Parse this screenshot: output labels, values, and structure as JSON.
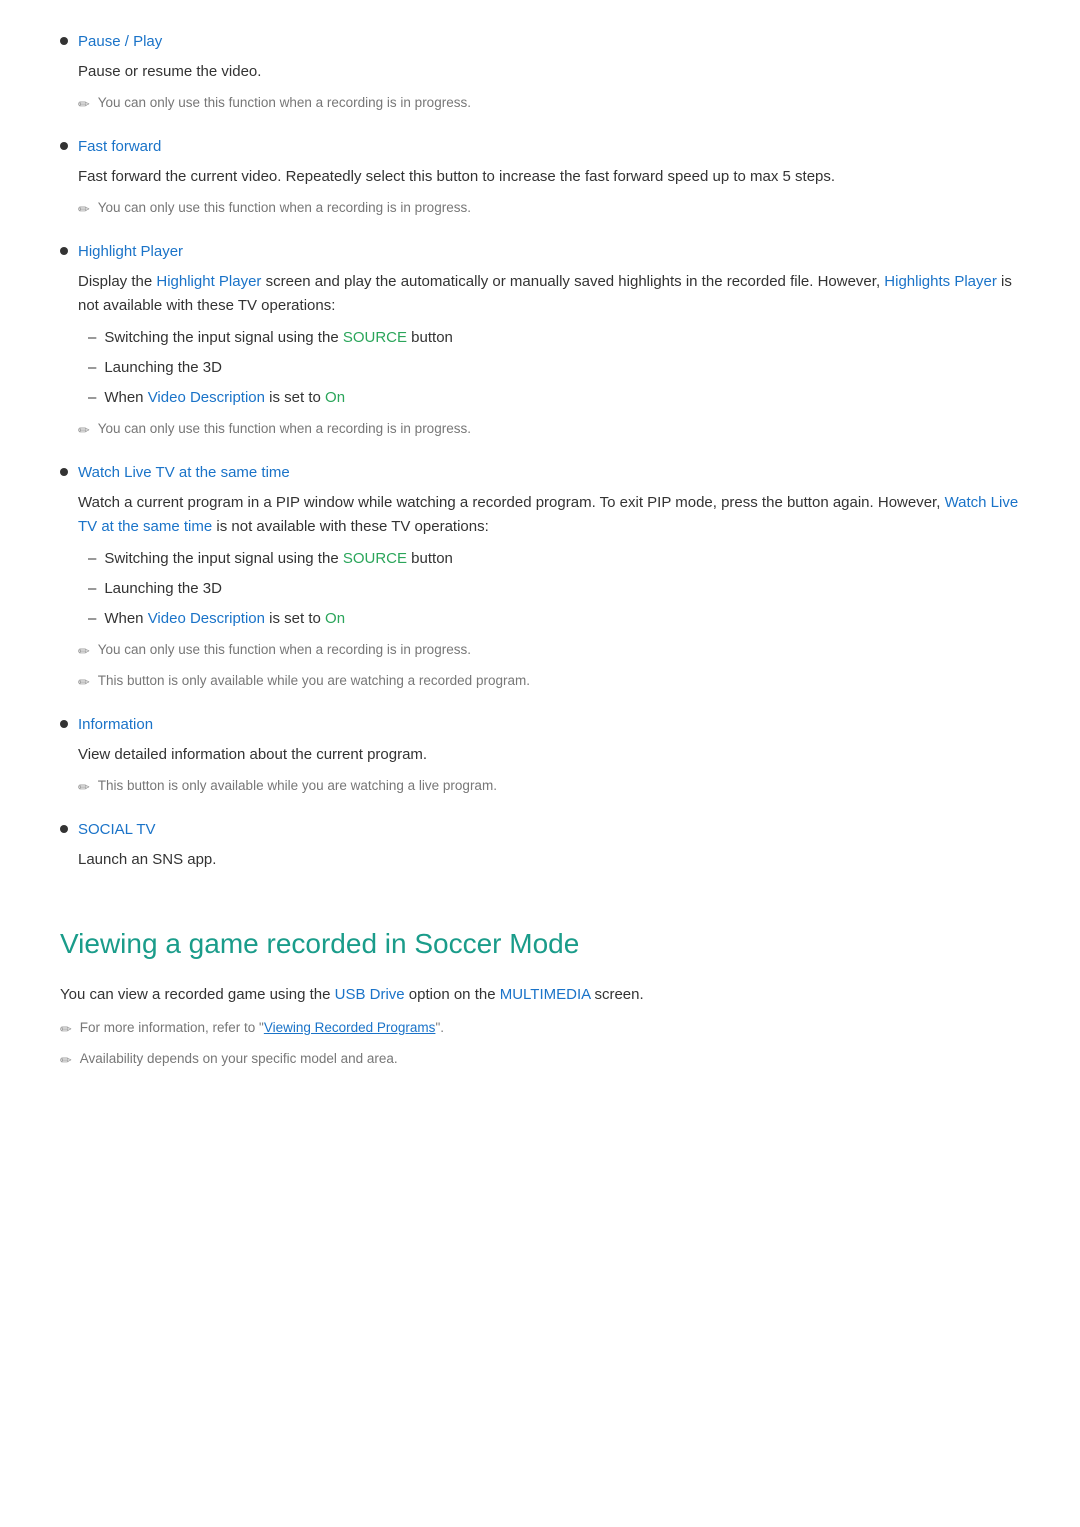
{
  "bullet_items": [
    {
      "id": "pause-play",
      "title_parts": [
        {
          "text": "Pause",
          "link": true
        },
        {
          "text": " / ",
          "link": false
        },
        {
          "text": "Play",
          "link": true
        }
      ],
      "body": "Pause or resume the video.",
      "notes": [
        "You can only use this function when a recording is in progress."
      ],
      "sub_items": []
    },
    {
      "id": "fast-forward",
      "title_parts": [
        {
          "text": "Fast forward",
          "link": true
        }
      ],
      "body": "Fast forward the current video. Repeatedly select this button to increase the fast forward speed up to max 5 steps.",
      "notes": [
        "You can only use this function when a recording is in progress."
      ],
      "sub_items": []
    },
    {
      "id": "highlight-player",
      "title_parts": [
        {
          "text": "Highlight Player",
          "link": true
        }
      ],
      "body_html": "Display the <link>Highlight Player</link> screen and play the automatically or manually saved highlights in the recorded file. However, <link>Highlights Player</link> is not available with these TV operations:",
      "sub_items": [
        "Switching the input signal using the SOURCE button",
        "Launching the 3D",
        "When Video Description is set to On"
      ],
      "notes": [
        "You can only use this function when a recording is in progress."
      ]
    },
    {
      "id": "watch-live-tv",
      "title_parts": [
        {
          "text": "Watch Live TV at the same time",
          "link": true
        }
      ],
      "body_html": "Watch a current program in a PIP window while watching a recorded program. To exit PIP mode, press the button again. However, <link>Watch Live TV at the same time</link> is not available with these TV operations:",
      "sub_items": [
        "Switching the input signal using the SOURCE button",
        "Launching the 3D",
        "When Video Description is set to On"
      ],
      "notes": [
        "You can only use this function when a recording is in progress.",
        "This button is only available while you are watching a recorded program."
      ]
    },
    {
      "id": "information",
      "title_parts": [
        {
          "text": "Information",
          "link": true
        }
      ],
      "body": "View detailed information about the current program.",
      "notes": [
        "This button is only available while you are watching a live program."
      ],
      "sub_items": []
    },
    {
      "id": "social-tv",
      "title_parts": [
        {
          "text": "SOCIAL TV",
          "link": true
        }
      ],
      "body": "Launch an SNS app.",
      "notes": [],
      "sub_items": []
    }
  ],
  "section": {
    "title": "Viewing a game recorded in Soccer Mode",
    "intro": "You can view a recorded game using the USB Drive option on the MULTIMEDIA screen.",
    "notes": [
      "For more information, refer to \"Viewing Recorded Programs\".",
      "Availability depends on your specific model and area."
    ]
  },
  "labels": {
    "pause": "Pause",
    "play": "Play",
    "fast_forward": "Fast forward",
    "highlight_player": "Highlight Player",
    "highlights_player": "Highlights Player",
    "watch_live_tv": "Watch Live TV at the same time",
    "information": "Information",
    "social_tv": "SOCIAL TV",
    "source": "SOURCE",
    "video_description": "Video Description",
    "on": "On",
    "usb_drive": "USB Drive",
    "multimedia": "MULTIMEDIA",
    "viewing_recorded": "Viewing Recorded Programs"
  }
}
